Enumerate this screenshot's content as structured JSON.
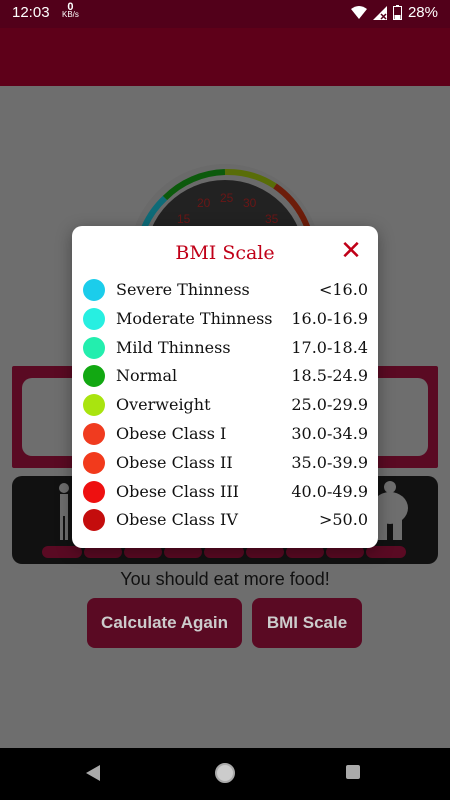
{
  "status_bar": {
    "time": "12:03",
    "net_speed_value": "0",
    "net_speed_unit": "KB/s",
    "battery": "28%"
  },
  "background": {
    "gauge_ticks": [
      "15",
      "20",
      "25",
      "30",
      "35"
    ],
    "advice": "You should eat more food!",
    "calculate_again_label": "Calculate Again",
    "bmi_scale_label": "BMI Scale"
  },
  "dialog": {
    "title": "BMI Scale",
    "close_symbol": "✕",
    "rows": [
      {
        "label": "Severe Thinness",
        "range": "<16.0",
        "color": "#1bcdeb"
      },
      {
        "label": "Moderate Thinness",
        "range": "16.0-16.9",
        "color": "#27efe1"
      },
      {
        "label": "Mild Thinness",
        "range": "17.0-18.4",
        "color": "#23eeae"
      },
      {
        "label": "Normal",
        "range": "18.5-24.9",
        "color": "#12a812"
      },
      {
        "label": "Overweight",
        "range": "25.0-29.9",
        "color": "#a9e40f"
      },
      {
        "label": "Obese Class I",
        "range": "30.0-34.9",
        "color": "#f03b1f"
      },
      {
        "label": "Obese Class II",
        "range": "35.0-39.9",
        "color": "#f23a1c"
      },
      {
        "label": "Obese Class III",
        "range": "40.0-49.9",
        "color": "#ee1010"
      },
      {
        "label": "Obese Class IV",
        "range": ">50.0",
        "color": "#c40d0d"
      }
    ]
  }
}
